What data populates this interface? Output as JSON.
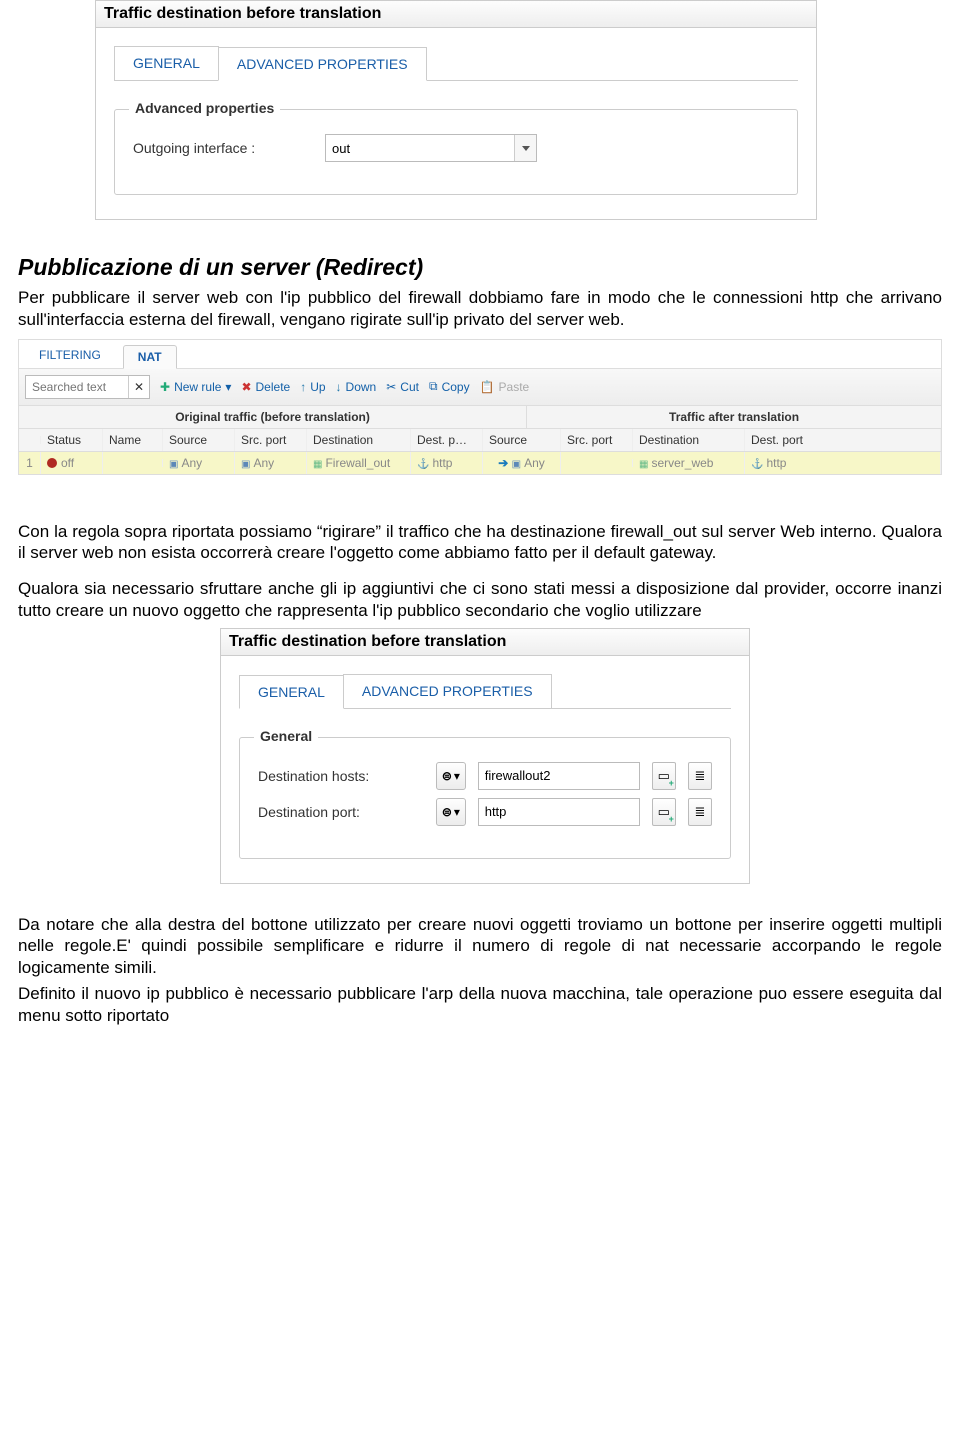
{
  "dialog_top": {
    "title": "Traffic destination before translation",
    "tabs": {
      "general": "GENERAL",
      "advanced": "ADVANCED PROPERTIES",
      "active": "advanced"
    },
    "fieldset_legend": "Advanced properties",
    "outgoing_interface_label": "Outgoing interface :",
    "outgoing_interface_value": "out"
  },
  "text": {
    "heading1": "Pubblicazione di un server (Redirect)",
    "para1": "Per pubblicare il server web con l'ip pubblico del firewall dobbiamo fare in modo che le connessioni http che arrivano sull'interfaccia esterna del firewall, vengano rigirate sull'ip privato del server web.",
    "para2": "Con la regola sopra riportata possiamo “rigirare” il traffico che ha destinazione firewall_out sul server Web interno. Qualora il server web  non esista occorrerà creare l'oggetto come abbiamo fatto per il default gateway.",
    "para3": "Qualora sia necessario sfruttare anche gli ip aggiuntivi che ci sono stati messi a disposizione dal provider, occorre inanzi tutto creare un nuovo oggetto che rappresenta l'ip pubblico secondario che voglio utilizzare",
    "para4": "Da notare che alla destra del bottone utilizzato per creare nuovi oggetti troviamo un bottone per inserire oggetti multipli nelle regole.E' quindi possibile semplificare e ridurre il numero di regole di nat necessarie accorpando le regole logicamente simili.",
    "para5": "Definito il nuovo ip pubblico è necessario pubblicare l'arp della nuova macchina, tale operazione puo essere eseguita dal menu sotto riportato"
  },
  "nat": {
    "tabs": {
      "filtering": "FILTERING",
      "nat": "NAT",
      "active": "nat"
    },
    "search_placeholder": "Searched text",
    "toolbar": {
      "new_rule": "New rule",
      "delete": "Delete",
      "up": "Up",
      "down": "Down",
      "cut": "Cut",
      "copy": "Copy",
      "paste": "Paste"
    },
    "group_headers": {
      "original": "Original traffic (before translation)",
      "after": "Traffic after translation"
    },
    "columns": {
      "status": "Status",
      "name": "Name",
      "source": "Source",
      "src_port": "Src. port",
      "destination": "Destination",
      "dest_port": "Dest. p…",
      "source2": "Source",
      "src_port2": "Src. port",
      "destination2": "Destination",
      "dest_port2": "Dest. port"
    },
    "row": {
      "num": "1",
      "status": "off",
      "source": "Any",
      "src_port": "Any",
      "destination": "Firewall_out",
      "dest_port": "http",
      "source2": "Any",
      "destination2": "server_web",
      "dest_port2": "http"
    }
  },
  "dialog_bottom": {
    "title": "Traffic destination before translation",
    "tabs": {
      "general": "GENERAL",
      "advanced": "ADVANCED PROPERTIES",
      "active": "general"
    },
    "fieldset_legend": "General",
    "dest_hosts_label": "Destination hosts:",
    "dest_hosts_value": "firewallout2",
    "dest_port_label": "Destination port:",
    "dest_port_value": "http"
  }
}
